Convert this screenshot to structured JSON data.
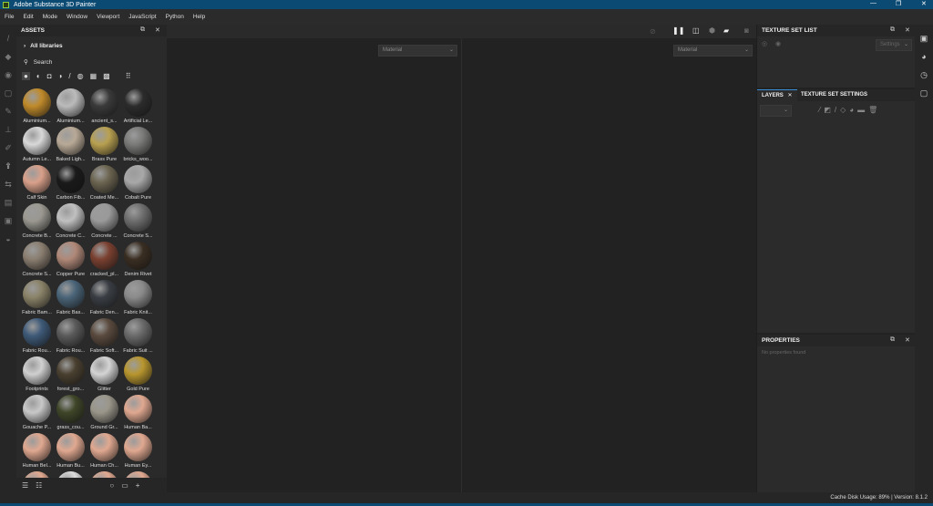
{
  "app": {
    "title": "Adobe Substance 3D Painter",
    "logo": "Pt"
  },
  "menu": [
    "File",
    "Edit",
    "Mode",
    "Window",
    "Viewport",
    "JavaScript",
    "Python",
    "Help"
  ],
  "assets": {
    "title": "ASSETS",
    "breadcrumb": "All libraries",
    "search_placeholder": "Search",
    "items": [
      {
        "label": "Aluminium...",
        "color": "#c08a2a"
      },
      {
        "label": "Aluminium...",
        "color": "#bbbbbb"
      },
      {
        "label": "ancient_s...",
        "color": "#3a3a3a"
      },
      {
        "label": "Artificial Le...",
        "color": "#2c2c2c"
      },
      {
        "label": "Autumn Le...",
        "color": "#d8d8d8"
      },
      {
        "label": "Baked Ligh...",
        "color": "#b8a996"
      },
      {
        "label": "Brass Pure",
        "color": "#b8a050"
      },
      {
        "label": "bricks_woo...",
        "color": "#7a7a78"
      },
      {
        "label": "Calf Skin",
        "color": "#d9a08a"
      },
      {
        "label": "Carbon Fib...",
        "color": "#1a1a1a"
      },
      {
        "label": "Coated Me...",
        "color": "#6b6450"
      },
      {
        "label": "Cobalt Pure",
        "color": "#a8a8a8"
      },
      {
        "label": "Concrete B...",
        "color": "#9a9890"
      },
      {
        "label": "Concrete C...",
        "color": "#c0c0c0"
      },
      {
        "label": "Concrete ...",
        "color": "#9a9a9a"
      },
      {
        "label": "Concrete S...",
        "color": "#6e6e6e"
      },
      {
        "label": "Concrete S...",
        "color": "#8a7e70"
      },
      {
        "label": "Copper Pure",
        "color": "#b08878"
      },
      {
        "label": "cracked_pl...",
        "color": "#7a4030"
      },
      {
        "label": "Denim Rivet",
        "color": "#3a2e22"
      },
      {
        "label": "Fabric Bam...",
        "color": "#8a8268"
      },
      {
        "label": "Fabric Bas...",
        "color": "#4a6478"
      },
      {
        "label": "Fabric Den...",
        "color": "#3a3e44"
      },
      {
        "label": "Fabric Knit...",
        "color": "#8a8a8a"
      },
      {
        "label": "Fabric Rou...",
        "color": "#3e5a78"
      },
      {
        "label": "Fabric Rou...",
        "color": "#5a5a5a"
      },
      {
        "label": "Fabric Soft...",
        "color": "#5a4a3e"
      },
      {
        "label": "Fabric Suit ...",
        "color": "#6a6a6a"
      },
      {
        "label": "Footprints",
        "color": "#d0d0d0"
      },
      {
        "label": "forest_gro...",
        "color": "#4a4030"
      },
      {
        "label": "Glitter",
        "color": "#d4d4d4"
      },
      {
        "label": "Gold Pure",
        "color": "#b8962e"
      },
      {
        "label": "Gouache P...",
        "color": "#c8c8c8"
      },
      {
        "label": "grass_cou...",
        "color": "#3e4628"
      },
      {
        "label": "Ground Gr...",
        "color": "#9a968a"
      },
      {
        "label": "Human Ba...",
        "color": "#e0a890"
      },
      {
        "label": "Human Bel...",
        "color": "#e0a890"
      },
      {
        "label": "Human Bu...",
        "color": "#e0a890"
      },
      {
        "label": "Human Ch...",
        "color": "#e0a890"
      },
      {
        "label": "Human Ey...",
        "color": "#e0a890"
      },
      {
        "label": "",
        "color": "#e0a890"
      },
      {
        "label": "",
        "color": "#ddd"
      },
      {
        "label": "",
        "color": "#e0a890"
      },
      {
        "label": "",
        "color": "#e0a890"
      }
    ]
  },
  "viewport": {
    "left_dropdown": "Material",
    "right_dropdown": "Material"
  },
  "texture_set_list": {
    "title": "TEXTURE SET LIST",
    "settings": "Settings"
  },
  "layers": {
    "tab_layers": "LAYERS",
    "tab_settings": "TEXTURE SET SETTINGS"
  },
  "properties": {
    "title": "PROPERTIES",
    "empty": "No properties found"
  },
  "status": {
    "text": "Cache Disk Usage:   89% | Version: 8.1.2"
  },
  "colors": {
    "accent": "#0b4a73",
    "tab_accent": "#3b8ed8"
  }
}
